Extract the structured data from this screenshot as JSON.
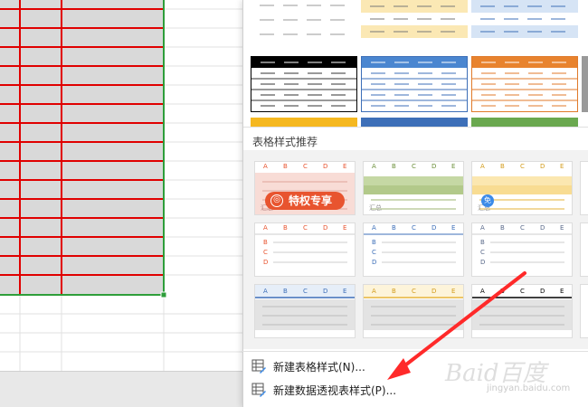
{
  "panel": {
    "section_title": "表格样式推荐",
    "promo_label": "特权专享",
    "promo_icon_glyph": "◎",
    "free_badge": "免",
    "thumb_headers": [
      "A",
      "B",
      "C",
      "D",
      "E"
    ],
    "row_labels": [
      "B",
      "C",
      "D"
    ],
    "summary_label": "汇总",
    "summary_label_short": "汇总",
    "accent_colors": [
      "#e8542f",
      "#8aab5c",
      "#e6b33a",
      "#3d6fb8",
      "#888888",
      "#000000"
    ]
  },
  "menu": {
    "new_table_style": "新建表格样式(N)...",
    "new_pivot_style": "新建数据透视表样式(P)..."
  },
  "watermark": {
    "main": "Baid百度",
    "sub": "jingyan.baidu.com"
  }
}
